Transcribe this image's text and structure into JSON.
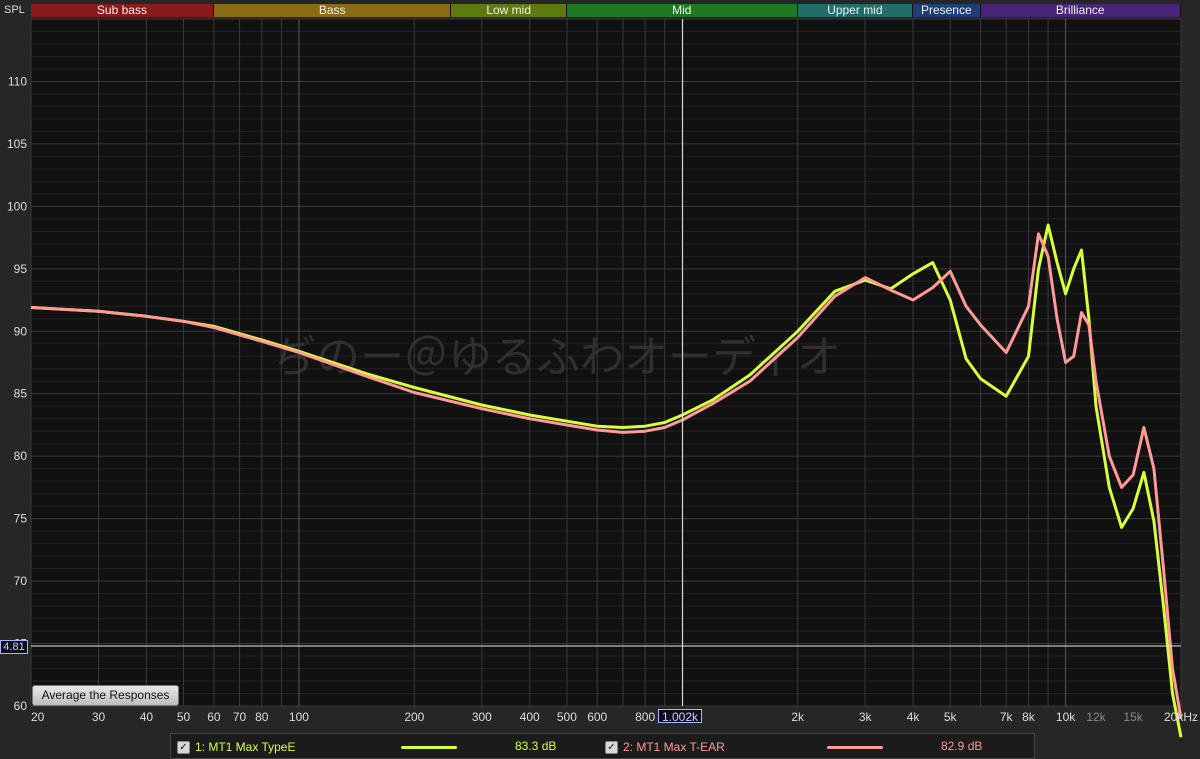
{
  "app": {
    "spl_label": "SPL",
    "average_button": "Average the Responses",
    "cursor_x_readout": "1.002k",
    "cursor_y_readout": "4.81",
    "watermark": "ぢのー＠ゆるふわオーディオ"
  },
  "bands": [
    {
      "label": "Sub bass",
      "color": "#8b1a1a"
    },
    {
      "label": "Bass",
      "color": "#8a6a12"
    },
    {
      "label": "Low mid",
      "color": "#5c7a10"
    },
    {
      "label": "Mid",
      "color": "#1e7a22"
    },
    {
      "label": "Upper mid",
      "color": "#1f6e6a"
    },
    {
      "label": "Presence",
      "color": "#1c3f7a"
    },
    {
      "label": "Brilliance",
      "color": "#4a2478"
    }
  ],
  "legend": [
    {
      "check": "✓",
      "label": "1: MT1 Max TypeE",
      "value": "83.3 dB",
      "color": "#d9ff3a"
    },
    {
      "check": "✓",
      "label": "2: MT1 Max T-EAR",
      "value": "82.9 dB",
      "color": "#ff9a96"
    }
  ],
  "chart_data": {
    "type": "line",
    "xscale": "log",
    "xlim": [
      20,
      20000
    ],
    "ylim": [
      60,
      115
    ],
    "y_ticks": [
      "60",
      "65",
      "70",
      "75",
      "80",
      "85",
      "90",
      "95",
      "100",
      "105",
      "110"
    ],
    "x_ticks": [
      {
        "f": 20,
        "label": "20"
      },
      {
        "f": 30,
        "label": "30"
      },
      {
        "f": 40,
        "label": "40"
      },
      {
        "f": 50,
        "label": "50"
      },
      {
        "f": 60,
        "label": "60"
      },
      {
        "f": 70,
        "label": "70"
      },
      {
        "f": 80,
        "label": "80"
      },
      {
        "f": 100,
        "label": "100"
      },
      {
        "f": 200,
        "label": "200"
      },
      {
        "f": 300,
        "label": "300"
      },
      {
        "f": 400,
        "label": "400"
      },
      {
        "f": 500,
        "label": "500"
      },
      {
        "f": 600,
        "label": "600"
      },
      {
        "f": 800,
        "label": "800"
      },
      {
        "f": 2000,
        "label": "2k"
      },
      {
        "f": 3000,
        "label": "3k"
      },
      {
        "f": 4000,
        "label": "4k"
      },
      {
        "f": 5000,
        "label": "5k"
      },
      {
        "f": 7000,
        "label": "7k"
      },
      {
        "f": 8000,
        "label": "8k"
      },
      {
        "f": 10000,
        "label": "10k"
      },
      {
        "f": 12000,
        "label": "12k"
      },
      {
        "f": 15000,
        "label": "15k"
      },
      {
        "f": 20000,
        "label": "20kHz"
      }
    ],
    "grid": true,
    "series": [
      {
        "name": "1: MT1 Max TypeE",
        "color": "#d9ff3a",
        "points": [
          [
            20,
            91.9
          ],
          [
            30,
            91.6
          ],
          [
            40,
            91.2
          ],
          [
            50,
            90.8
          ],
          [
            60,
            90.4
          ],
          [
            80,
            89.3
          ],
          [
            100,
            88.4
          ],
          [
            150,
            86.6
          ],
          [
            200,
            85.5
          ],
          [
            300,
            84.1
          ],
          [
            400,
            83.3
          ],
          [
            500,
            82.8
          ],
          [
            600,
            82.4
          ],
          [
            700,
            82.3
          ],
          [
            800,
            82.4
          ],
          [
            900,
            82.7
          ],
          [
            1000,
            83.3
          ],
          [
            1200,
            84.5
          ],
          [
            1500,
            86.5
          ],
          [
            2000,
            90.0
          ],
          [
            2500,
            93.2
          ],
          [
            3000,
            94.1
          ],
          [
            3500,
            93.4
          ],
          [
            4000,
            94.6
          ],
          [
            4500,
            95.5
          ],
          [
            5000,
            92.5
          ],
          [
            5500,
            87.8
          ],
          [
            6000,
            86.2
          ],
          [
            7000,
            84.8
          ],
          [
            8000,
            88.0
          ],
          [
            8500,
            95.0
          ],
          [
            9000,
            98.5
          ],
          [
            9500,
            95.5
          ],
          [
            10000,
            93.0
          ],
          [
            10500,
            95.0
          ],
          [
            11000,
            96.5
          ],
          [
            11500,
            91.0
          ],
          [
            12000,
            84.0
          ],
          [
            13000,
            77.5
          ],
          [
            14000,
            74.3
          ],
          [
            15000,
            75.8
          ],
          [
            16000,
            78.7
          ],
          [
            17000,
            74.8
          ],
          [
            18000,
            68.0
          ],
          [
            19000,
            61.0
          ],
          [
            20000,
            57.5
          ]
        ]
      },
      {
        "name": "2: MT1 Max T-EAR",
        "color": "#ff9a96",
        "points": [
          [
            20,
            91.9
          ],
          [
            30,
            91.6
          ],
          [
            40,
            91.2
          ],
          [
            50,
            90.8
          ],
          [
            60,
            90.3
          ],
          [
            80,
            89.2
          ],
          [
            100,
            88.3
          ],
          [
            150,
            86.4
          ],
          [
            200,
            85.1
          ],
          [
            300,
            83.8
          ],
          [
            400,
            83.0
          ],
          [
            500,
            82.5
          ],
          [
            600,
            82.1
          ],
          [
            700,
            81.9
          ],
          [
            800,
            82.0
          ],
          [
            900,
            82.3
          ],
          [
            1000,
            82.9
          ],
          [
            1200,
            84.2
          ],
          [
            1500,
            86.0
          ],
          [
            2000,
            89.5
          ],
          [
            2500,
            92.8
          ],
          [
            3000,
            94.3
          ],
          [
            3500,
            93.3
          ],
          [
            4000,
            92.5
          ],
          [
            4500,
            93.5
          ],
          [
            5000,
            94.8
          ],
          [
            5500,
            92.0
          ],
          [
            6000,
            90.5
          ],
          [
            7000,
            88.3
          ],
          [
            8000,
            92.0
          ],
          [
            8500,
            97.8
          ],
          [
            9000,
            96.0
          ],
          [
            9500,
            91.0
          ],
          [
            10000,
            87.5
          ],
          [
            10500,
            88.0
          ],
          [
            11000,
            91.5
          ],
          [
            11500,
            90.5
          ],
          [
            12000,
            86.0
          ],
          [
            13000,
            80.0
          ],
          [
            14000,
            77.5
          ],
          [
            15000,
            78.5
          ],
          [
            16000,
            82.3
          ],
          [
            17000,
            79.0
          ],
          [
            18000,
            71.0
          ],
          [
            19000,
            63.0
          ],
          [
            20000,
            59.0
          ]
        ]
      }
    ]
  }
}
